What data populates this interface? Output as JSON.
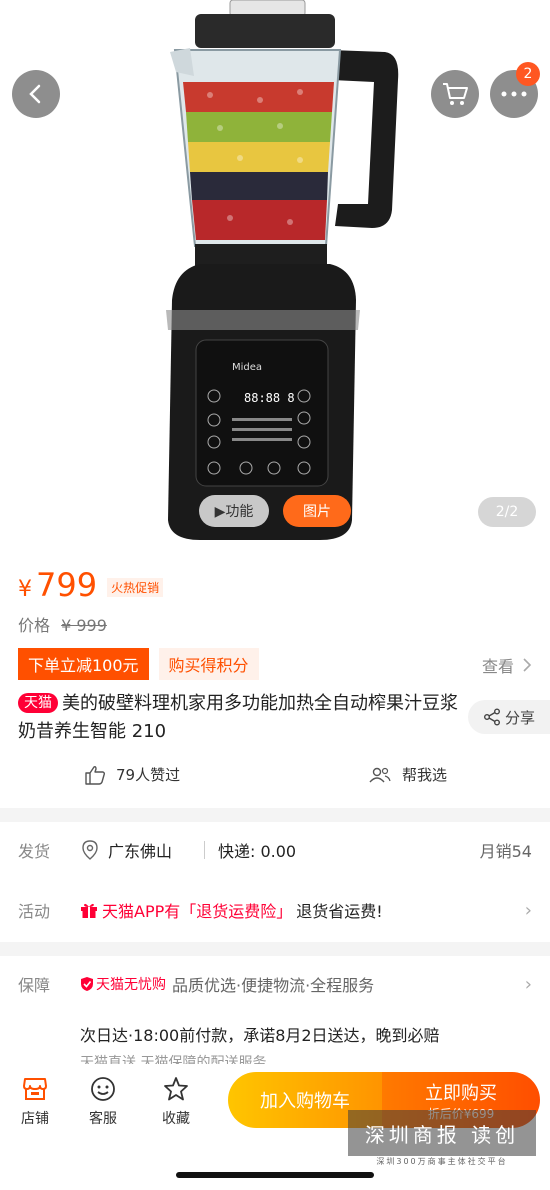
{
  "hero": {
    "video_label": "▶功能",
    "photo_label": "图片",
    "pager": "2/2",
    "cart_badge": "2",
    "panel_brand": "Midea"
  },
  "price": {
    "currency": "¥",
    "value": "799",
    "promo": "火热促销",
    "orig_label": "价格",
    "orig_value": "¥ 999"
  },
  "tags": {
    "discount": "下单立减100元",
    "points": "购买得积分",
    "view_more": "查看"
  },
  "product": {
    "store_tag": "天猫",
    "title": "美的破壁料理机家用多功能加热全自动榨果汁豆浆奶昔养生智能 210",
    "share": "分享",
    "likes": "79人赞过",
    "help_choose": "帮我选"
  },
  "shipping": {
    "label": "发货",
    "location": "广东佛山",
    "express": "快递: 0.00",
    "monthly_sales": "月销54"
  },
  "activity": {
    "label": "活动",
    "red_text": "天猫APP有「退货运费险」",
    "rest_text": "退货省运费!"
  },
  "guarantee": {
    "label": "保障",
    "badge": "天猫无忧购",
    "items": "品质优选·便捷物流·全程服务",
    "next_day": "次日达·18:00前付款，承诺8月2日送达，晚到必赔",
    "direct": "天猫直送 天猫保障的配送服务"
  },
  "bottom": {
    "store": "店铺",
    "service": "客服",
    "favorite": "收藏",
    "add_cart": "加入购物车",
    "buy_now": "立即购买",
    "after_discount": "折后价¥699"
  },
  "watermark": {
    "main": "深圳商报 读创",
    "sub": "深圳300万商事主体社交平台"
  }
}
